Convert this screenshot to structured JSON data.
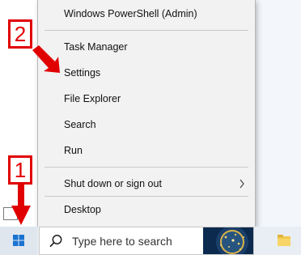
{
  "menu": {
    "items": [
      {
        "label": "Windows PowerShell (Admin)"
      },
      {
        "label": "Task Manager"
      },
      {
        "label": "Settings"
      },
      {
        "label": "File Explorer"
      },
      {
        "label": "Search"
      },
      {
        "label": "Run"
      },
      {
        "label": "Shut down or sign out",
        "submenu": true
      },
      {
        "label": "Desktop"
      }
    ]
  },
  "taskbar": {
    "search_placeholder": "Type here to search"
  },
  "annotations": {
    "badge_1": "1",
    "badge_2": "2"
  },
  "colors": {
    "annotation": "#e10000",
    "menu_bg": "#f2f2f2",
    "windows_blue": "#1a73d1"
  }
}
